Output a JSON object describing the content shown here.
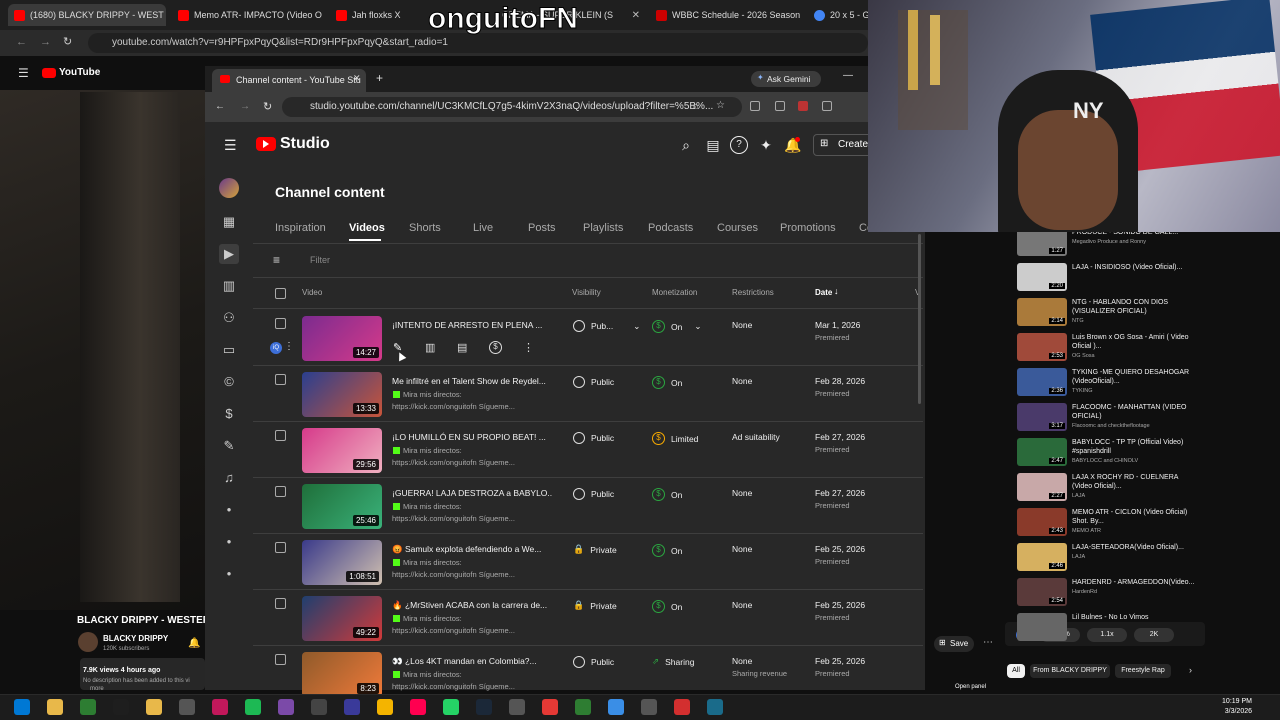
{
  "back_browser": {
    "tabs": [
      "(1680) BLACKY DRIPPY - WEST",
      "Memo ATR- IMPACTO (Video O",
      "Jah floxks X",
      "CREMA - SUPER KLEIN (S",
      "WBBC Schedule - 2026 Season",
      "20 x 5 - Go"
    ],
    "url": "youtube.com/watch?v=r9HPFpxPqyQ&list=RDr9HPFpxPqyQ&start_radio=1",
    "logo": "YouTube"
  },
  "overlay_name": "onguitoFN",
  "front_browser": {
    "tab": "Channel content - YouTube Stu",
    "url": "studio.youtube.com/channel/UC3KMCfLQ7g5-4kimV2X3naQ/videos/upload?filter=%5B%...",
    "ask_gemini": "Ask Gemini"
  },
  "studio": {
    "logo": "Studio",
    "create": "Create",
    "page_title": "Channel content",
    "tabs": [
      "Inspiration",
      "Videos",
      "Shorts",
      "Live",
      "Posts",
      "Playlists",
      "Podcasts",
      "Courses",
      "Promotions",
      "Co"
    ],
    "filter_placeholder": "Filter",
    "columns": {
      "video": "Video",
      "visibility": "Visibility",
      "monetization": "Monetization",
      "restrictions": "Restrictions",
      "date": "Date"
    },
    "rows": [
      {
        "title": "¡INTENTO DE ARRESTO EN PLENA ...",
        "desc1": "",
        "desc2": "",
        "duration": "14:27",
        "visibility": "Pub...",
        "monetization": "On",
        "restrictions": "None",
        "restrictions2": "",
        "date": "Mar 1, 2026",
        "status": "Premiered"
      },
      {
        "title": "Me infiltré en el Talent Show de Reydel...",
        "desc1": "Mira mis directos:",
        "desc2": "https://kick.com/onguitofn Sígueme...",
        "duration": "13:33",
        "visibility": "Public",
        "monetization": "On",
        "restrictions": "None",
        "restrictions2": "",
        "date": "Feb 28, 2026",
        "status": "Premiered"
      },
      {
        "title": "¡LO HUMILLÓ EN SU PROPIO BEAT! ...",
        "desc1": "Mira mis directos:",
        "desc2": "https://kick.com/onguitofn Sígueme...",
        "duration": "29:56",
        "visibility": "Public",
        "monetization": "Limited",
        "restrictions": "Ad suitability",
        "restrictions2": "",
        "date": "Feb 27, 2026",
        "status": "Premiered"
      },
      {
        "title": "¡GUERRA! LAJA DESTROZA a BABYLO...",
        "desc1": "Mira mis directos:",
        "desc2": "https://kick.com/onguitofn Sígueme...",
        "duration": "25:46",
        "visibility": "Public",
        "monetization": "On",
        "restrictions": "None",
        "restrictions2": "",
        "date": "Feb 27, 2026",
        "status": "Premiered"
      },
      {
        "title": "😡 Samulx explota defendiendo a We...",
        "desc1": "Mira mis directos:",
        "desc2": "https://kick.com/onguitofn Sígueme...",
        "duration": "1:08:51",
        "visibility": "Private",
        "monetization": "On",
        "restrictions": "None",
        "restrictions2": "",
        "date": "Feb 25, 2026",
        "status": "Premiered"
      },
      {
        "title": "🔥 ¿MrStiven ACABA con la carrera de...",
        "desc1": "Mira mis directos:",
        "desc2": "https://kick.com/onguitofn Sígueme...",
        "duration": "49:22",
        "visibility": "Private",
        "monetization": "On",
        "restrictions": "None",
        "restrictions2": "",
        "date": "Feb 25, 2026",
        "status": "Premiered"
      },
      {
        "title": "👀 ¿Los 4KT mandan en Colombia?...",
        "desc1": "Mira mis directos:",
        "desc2": "https://kick.com/onguitofn Sígueme...",
        "duration": "8:23",
        "visibility": "Public",
        "monetization": "Sharing",
        "restrictions": "None",
        "restrictions2": "Sharing revenue",
        "date": "Feb 25, 2026",
        "status": "Premiered"
      }
    ]
  },
  "back_video": {
    "title": "BLACKY DRIPPY - WESTERN",
    "channel": "BLACKY DRIPPY",
    "subs": "120K subscribers",
    "views": "7.9K views 4 hours ago",
    "desc": "No description has been added to this vi",
    "more": "more"
  },
  "recommendations": [
    {
      "title": "PRODUCE - SONIDO DE GALL...",
      "channel": "Megadivo Produce and Ronny",
      "dur": "1:27"
    },
    {
      "title": "LAJA - INSIDIOSO (Video Oficial)...",
      "channel": "",
      "dur": "2:20"
    },
    {
      "title": "NTG - HABLANDO CON DIOS (VISUALIZER OFICIAL)",
      "channel": "NTG",
      "dur": "2:14"
    },
    {
      "title": "Luis Brown x OG Sosa - Amiri ( Video Oficial )...",
      "channel": "OG Sosa",
      "dur": "2:53"
    },
    {
      "title": "TYKING -ME QUIERO DESAHOGAR (VideoOficial)...",
      "channel": "TYKING",
      "dur": "2:36"
    },
    {
      "title": "FLACOOMC - MANHATTAN (VIDEO OFICIAL)",
      "channel": "Flacoomc and checktheflootage",
      "dur": "3:17"
    },
    {
      "title": "BABYLOCC - TP TP (Official Video) #spanishdrill",
      "channel": "BABYLOCC and CHINOLV",
      "dur": "2:47"
    },
    {
      "title": "LAJA X ROCHY RD - CUELNERA (Video Oficial)...",
      "channel": "LAJA",
      "dur": "2:27"
    },
    {
      "title": "MEMO ATR - CICLON (Video Oficial) Shot. By...",
      "channel": "MEMO ATR",
      "dur": "2:43"
    },
    {
      "title": "LAJA-SETEADORA(Video Oficial)...",
      "channel": "LAJA",
      "dur": "2:46"
    },
    {
      "title": "HARDENRD - ARMAGEDDON(Video...",
      "channel": "HardenRd",
      "dur": "2:54"
    },
    {
      "title": "Lil Bulnes - No Lo Vimos",
      "channel": "",
      "dur": ""
    }
  ],
  "controls": {
    "save": "Save",
    "chips": [
      "All",
      "From BLACKY DRIPPY",
      "Freestyle Rap"
    ],
    "stats": [
      "23.9%",
      "1.1x",
      "2K"
    ],
    "open_panel": "Open panel"
  },
  "clock": {
    "time": "10:19 PM",
    "date": "3/3/2026"
  },
  "colors": {
    "studio_bg": "#282828",
    "yt_red": "#ff0000",
    "money_green": "#2ba640",
    "limited_yellow": "#f9ab00"
  }
}
